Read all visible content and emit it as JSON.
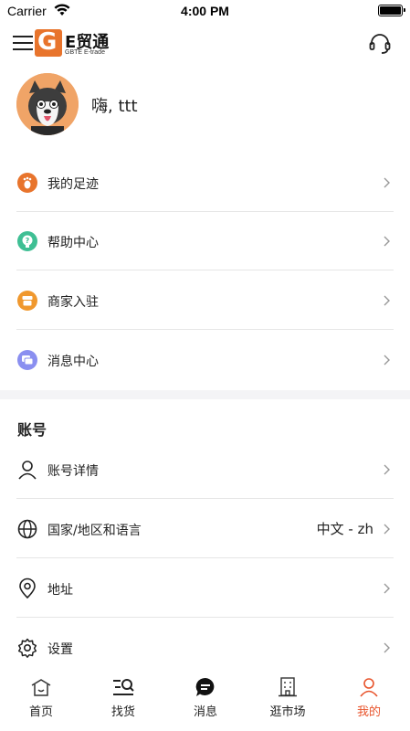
{
  "status_bar": {
    "carrier": "Carrier",
    "time": "4:00 PM"
  },
  "header": {
    "logo_letter": "G",
    "logo_name": "E贸通",
    "logo_sub": "GBTE E-trade",
    "brand_color": "#e8742c"
  },
  "profile": {
    "greeting": "嗨, ttt"
  },
  "menu": [
    {
      "label": "我的足迹",
      "icon": "footprint-icon",
      "color": "#e8742c"
    },
    {
      "label": "帮助中心",
      "icon": "help-icon",
      "color": "#3fbf94"
    },
    {
      "label": "商家入驻",
      "icon": "store-icon",
      "color": "#f0982e"
    },
    {
      "label": "消息中心",
      "icon": "message-icon",
      "color": "#8a8ff0"
    }
  ],
  "account": {
    "title": "账号",
    "items": [
      {
        "label": "账号详情",
        "icon": "user-icon",
        "value": ""
      },
      {
        "label": "国家/地区和语言",
        "icon": "globe-icon",
        "value": "中文 - zh"
      },
      {
        "label": "地址",
        "icon": "location-icon",
        "value": ""
      },
      {
        "label": "设置",
        "icon": "settings-icon",
        "value": ""
      }
    ]
  },
  "tabs": [
    {
      "label": "首页",
      "icon": "home-icon",
      "active": false
    },
    {
      "label": "找货",
      "icon": "search-goods-icon",
      "active": false
    },
    {
      "label": "消息",
      "icon": "chat-icon",
      "active": false
    },
    {
      "label": "逛市场",
      "icon": "market-icon",
      "active": false
    },
    {
      "label": "我的",
      "icon": "profile-icon",
      "active": true
    }
  ],
  "active_color": "#e8542c"
}
